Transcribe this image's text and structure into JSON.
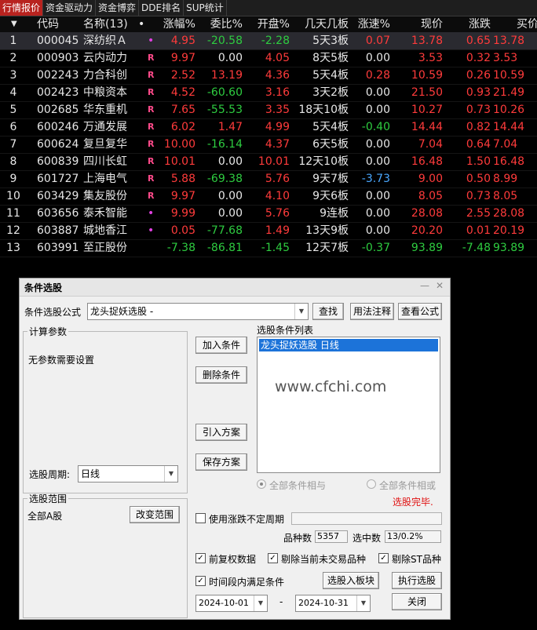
{
  "tabs": [
    "行情报价",
    "资金驱动力",
    "资金博弈",
    "DDE排名",
    "SUP统计"
  ],
  "header": {
    "sort_arrow": "▼",
    "code": "代码",
    "name": "名称(13)",
    "dot": "•",
    "change_pct": "涨幅%",
    "commit_ratio": "委比%",
    "open_pct": "开盘%",
    "streak": "几天几板",
    "speed": "涨速%",
    "price": "现价",
    "change": "涨跌",
    "bid": "买价"
  },
  "rows": [
    {
      "no": "1",
      "code": "000045",
      "name": "深纺织Ａ",
      "mark": "•",
      "change_pct": "4.95",
      "commit_ratio": "-20.58",
      "open_pct": "-2.28",
      "streak": "5天3板",
      "speed": "0.07",
      "price": "13.78",
      "change": "0.65",
      "bid": "13.78"
    },
    {
      "no": "2",
      "code": "000903",
      "name": "云内动力",
      "mark": "R",
      "change_pct": "9.97",
      "commit_ratio": "0.00",
      "open_pct": "4.05",
      "streak": "8天5板",
      "speed": "0.00",
      "price": "3.53",
      "change": "0.32",
      "bid": "3.53"
    },
    {
      "no": "3",
      "code": "002243",
      "name": "力合科创",
      "mark": "R",
      "change_pct": "2.52",
      "commit_ratio": "13.19",
      "open_pct": "4.36",
      "streak": "5天4板",
      "speed": "0.28",
      "price": "10.59",
      "change": "0.26",
      "bid": "10.59"
    },
    {
      "no": "4",
      "code": "002423",
      "name": "中粮资本",
      "mark": "R",
      "change_pct": "4.52",
      "commit_ratio": "-60.60",
      "open_pct": "3.16",
      "streak": "3天2板",
      "speed": "0.00",
      "price": "21.50",
      "change": "0.93",
      "bid": "21.49"
    },
    {
      "no": "5",
      "code": "002685",
      "name": "华东重机",
      "mark": "R",
      "change_pct": "7.65",
      "commit_ratio": "-55.53",
      "open_pct": "3.35",
      "streak": "18天10板",
      "speed": "0.00",
      "price": "10.27",
      "change": "0.73",
      "bid": "10.26"
    },
    {
      "no": "6",
      "code": "600246",
      "name": "万通发展",
      "mark": "R",
      "change_pct": "6.02",
      "commit_ratio": "1.47",
      "open_pct": "4.99",
      "streak": "5天4板",
      "speed": "-0.40",
      "price": "14.44",
      "change": "0.82",
      "bid": "14.44"
    },
    {
      "no": "7",
      "code": "600624",
      "name": "复旦复华",
      "mark": "R",
      "change_pct": "10.00",
      "commit_ratio": "-16.14",
      "open_pct": "4.37",
      "streak": "6天5板",
      "speed": "0.00",
      "price": "7.04",
      "change": "0.64",
      "bid": "7.04"
    },
    {
      "no": "8",
      "code": "600839",
      "name": "四川长虹",
      "mark": "R",
      "change_pct": "10.01",
      "commit_ratio": "0.00",
      "open_pct": "10.01",
      "streak": "12天10板",
      "speed": "0.00",
      "price": "16.48",
      "change": "1.50",
      "bid": "16.48"
    },
    {
      "no": "9",
      "code": "601727",
      "name": "上海电气",
      "mark": "R",
      "change_pct": "5.88",
      "commit_ratio": "-69.38",
      "open_pct": "5.76",
      "streak": "9天7板",
      "speed": "-3.73",
      "price": "9.00",
      "change": "0.50",
      "bid": "8.99"
    },
    {
      "no": "10",
      "code": "603429",
      "name": "集友股份",
      "mark": "R",
      "change_pct": "9.97",
      "commit_ratio": "0.00",
      "open_pct": "4.10",
      "streak": "9天6板",
      "speed": "0.00",
      "price": "8.05",
      "change": "0.73",
      "bid": "8.05"
    },
    {
      "no": "11",
      "code": "603656",
      "name": "泰禾智能",
      "mark": "•",
      "change_pct": "9.99",
      "commit_ratio": "0.00",
      "open_pct": "5.76",
      "streak": "9连板",
      "speed": "0.00",
      "price": "28.08",
      "change": "2.55",
      "bid": "28.08"
    },
    {
      "no": "12",
      "code": "603887",
      "name": "城地香江",
      "mark": "•",
      "change_pct": "0.05",
      "commit_ratio": "-77.68",
      "open_pct": "1.49",
      "streak": "13天9板",
      "speed": "0.00",
      "price": "20.20",
      "change": "0.01",
      "bid": "20.19"
    },
    {
      "no": "13",
      "code": "603991",
      "name": "至正股份",
      "mark": "",
      "change_pct": "-7.38",
      "commit_ratio": "-86.81",
      "open_pct": "-1.45",
      "streak": "12天7板",
      "speed": "-0.37",
      "price": "93.89",
      "change": "-7.48",
      "bid": "93.89"
    }
  ],
  "dialog": {
    "title": "条件选股",
    "formula_label": "条件选股公式",
    "formula_value": "龙头捉妖选股  -",
    "find_btn": "查找",
    "usage_btn": "用法注释",
    "view_btn": "查看公式",
    "calc_group": "计算参数",
    "no_params": "无参数需要设置",
    "period_label": "选股周期:",
    "period_value": "日线",
    "range_group": "选股范围",
    "range_value": "全部A股",
    "change_range_btn": "改变范围",
    "add_btn": "加入条件",
    "delete_btn": "删除条件",
    "import_btn": "引入方案",
    "save_btn": "保存方案",
    "list_label": "选股条件列表",
    "list_item": "龙头捉妖选股  日线",
    "watermark": "www.cfchi.com",
    "radio_and": "全部条件相与",
    "radio_or": "全部条件相或",
    "status": "选股完毕.",
    "use_period": "使用涨跌不定周期",
    "count_label": "品种数",
    "count_value": "5357",
    "selected_label": "选中数",
    "selected_value": "13/0.2%",
    "adj_data": "前复权数据",
    "excl_untraded": "剔除当前未交易品种",
    "excl_st": "剔除ST品种",
    "time_cond": "时间段内满足条件",
    "to_board_btn": "选股入板块",
    "execute_btn": "执行选股",
    "date_from": "2024-10-01",
    "date_sep": "-",
    "date_to": "2024-10-31",
    "close_btn": "关闭",
    "minimize_icon": "—",
    "close_icon": "✕"
  },
  "colors": {
    "up": "#ff3b3b",
    "down": "#2ecc40",
    "neutral": "#e8e8e8",
    "tab_active": "#b8231f",
    "list_select": "#1c73d9"
  }
}
